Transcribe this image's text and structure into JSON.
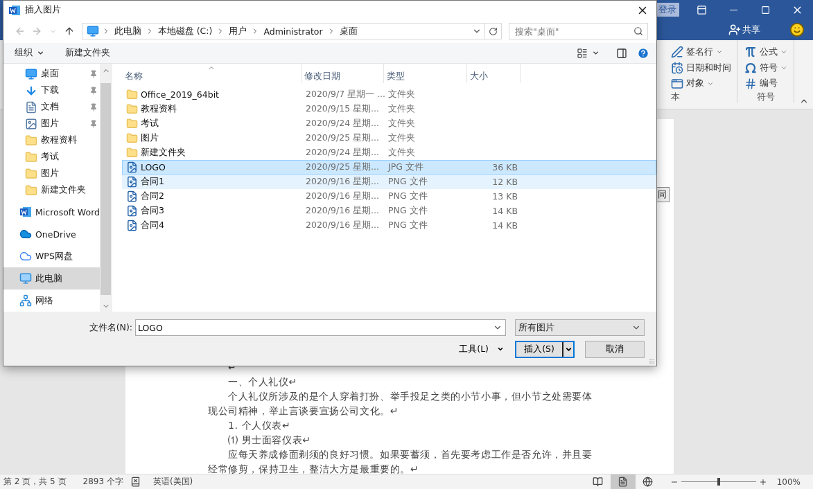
{
  "word": {
    "title_bar": {
      "login": "登录",
      "share": "共享"
    },
    "ribbon": {
      "groups": [
        {
          "label": "本",
          "items": [
            {
              "label": "签名行",
              "dropdown": true
            },
            {
              "label": "日期和时间",
              "dropdown": false
            },
            {
              "label": "对象",
              "dropdown": true
            }
          ]
        },
        {
          "label": "符号",
          "items": [
            {
              "label": "公式",
              "dropdown": true
            },
            {
              "label": "符号",
              "dropdown": true
            },
            {
              "label": "编号",
              "dropdown": false
            }
          ]
        }
      ]
    },
    "document": {
      "cut_box": "同",
      "paragraphs": [
        {
          "kind": "mark",
          "text": "↵"
        },
        {
          "kind": "indent",
          "text": "一、个人礼仪↵"
        },
        {
          "kind": "indent",
          "text": "个人礼仪所涉及的是个人穿着打扮、举手投足之类的小节小事，但小节之处需要体现公司精神，举止言谈要宣扬公司文化。↵"
        },
        {
          "kind": "indent",
          "text": "1.  个人仪表↵"
        },
        {
          "kind": "indent",
          "text": "⑴ 男士面容仪表↵"
        },
        {
          "kind": "indent",
          "text": "应每天养成修面剃须的良好习惯。如果要蓄须，首先要考虑工作是否允许，并且要经常修剪，保持卫生，整洁大方是最重要的。↵"
        }
      ]
    },
    "status_bar": {
      "page": "第 2 页，共 5 页",
      "words": "2893 个字",
      "language": "英语(美国)",
      "views": [
        {
          "kind": "read",
          "selected": false
        },
        {
          "kind": "print",
          "selected": true
        },
        {
          "kind": "web",
          "selected": false
        }
      ],
      "zoom_slider": {
        "level": 0.5
      },
      "zoom": "100%"
    }
  },
  "dialog": {
    "title": "插入图片",
    "address": {
      "path": [
        "此电脑",
        "本地磁盘 (C:)",
        "用户",
        "Administrator",
        "桌面"
      ]
    },
    "search": {
      "placeholder": "搜索\"桌面\""
    },
    "toolbar": {
      "organize": "组织",
      "new_folder": "新建文件夹"
    },
    "sidebar": {
      "items": [
        {
          "kind": "quick",
          "label": "桌面",
          "pinned": true,
          "selected": false
        },
        {
          "kind": "quick",
          "label": "下载",
          "pinned": true,
          "selected": false
        },
        {
          "kind": "quick",
          "label": "文档",
          "pinned": true,
          "selected": false
        },
        {
          "kind": "quick",
          "label": "图片",
          "pinned": true,
          "selected": false
        },
        {
          "kind": "quick",
          "label": "教程资料",
          "pinned": false,
          "selected": false
        },
        {
          "kind": "quick",
          "label": "考试",
          "pinned": false,
          "selected": false
        },
        {
          "kind": "quick",
          "label": "图片",
          "pinned": false,
          "selected": false
        },
        {
          "kind": "quick",
          "label": "新建文件夹",
          "pinned": false,
          "selected": false
        },
        {
          "kind": "place",
          "label": "Microsoft Word",
          "pinned": false,
          "selected": false
        },
        {
          "kind": "place",
          "label": "OneDrive",
          "pinned": false,
          "selected": false
        },
        {
          "kind": "place",
          "label": "WPS网盘",
          "pinned": false,
          "selected": false
        },
        {
          "kind": "place",
          "label": "此电脑",
          "pinned": false,
          "selected": true
        },
        {
          "kind": "place",
          "label": "网络",
          "pinned": false,
          "selected": false
        }
      ]
    },
    "columns": [
      {
        "label": "名称",
        "sorted": true
      },
      {
        "label": "修改日期",
        "sorted": false
      },
      {
        "label": "类型",
        "sorted": false
      },
      {
        "label": "大小",
        "sorted": false
      }
    ],
    "files": [
      {
        "kind": "folder",
        "name": "Office_2019_64bit",
        "date": "2020/9/7 星期一 ...",
        "type": "文件夹",
        "selected": false,
        "hovered": false
      },
      {
        "kind": "folder",
        "name": "教程资料",
        "date": "2020/9/15 星期...",
        "type": "文件夹",
        "selected": false,
        "hovered": false
      },
      {
        "kind": "folder",
        "name": "考试",
        "date": "2020/9/24 星期...",
        "type": "文件夹",
        "selected": false,
        "hovered": false
      },
      {
        "kind": "folder",
        "name": "图片",
        "date": "2020/9/25 星期...",
        "type": "文件夹",
        "selected": false,
        "hovered": false
      },
      {
        "kind": "folder",
        "name": "新建文件夹",
        "date": "2020/9/24 星期...",
        "type": "文件夹",
        "selected": false,
        "hovered": false
      },
      {
        "kind": "image",
        "name": "LOGO",
        "date": "2020/9/25 星期...",
        "type": "JPG 文件",
        "size": "36 KB",
        "selected": true,
        "hovered": false
      },
      {
        "kind": "image",
        "name": "合同1",
        "date": "2020/9/16 星期...",
        "type": "PNG 文件",
        "size": "12 KB",
        "selected": false,
        "hovered": true
      },
      {
        "kind": "image",
        "name": "合同2",
        "date": "2020/9/16 星期...",
        "type": "PNG 文件",
        "size": "13 KB",
        "selected": false,
        "hovered": false
      },
      {
        "kind": "image",
        "name": "合同3",
        "date": "2020/9/16 星期...",
        "type": "PNG 文件",
        "size": "14 KB",
        "selected": false,
        "hovered": false
      },
      {
        "kind": "image",
        "name": "合同4",
        "date": "2020/9/16 星期...",
        "type": "PNG 文件",
        "size": "14 KB",
        "selected": false,
        "hovered": false
      }
    ],
    "filename": {
      "label": "文件名(N):",
      "value": "LOGO"
    },
    "filter": "所有图片",
    "tools": "工具(L)",
    "insert": "插入(S)",
    "cancel": "取消"
  }
}
